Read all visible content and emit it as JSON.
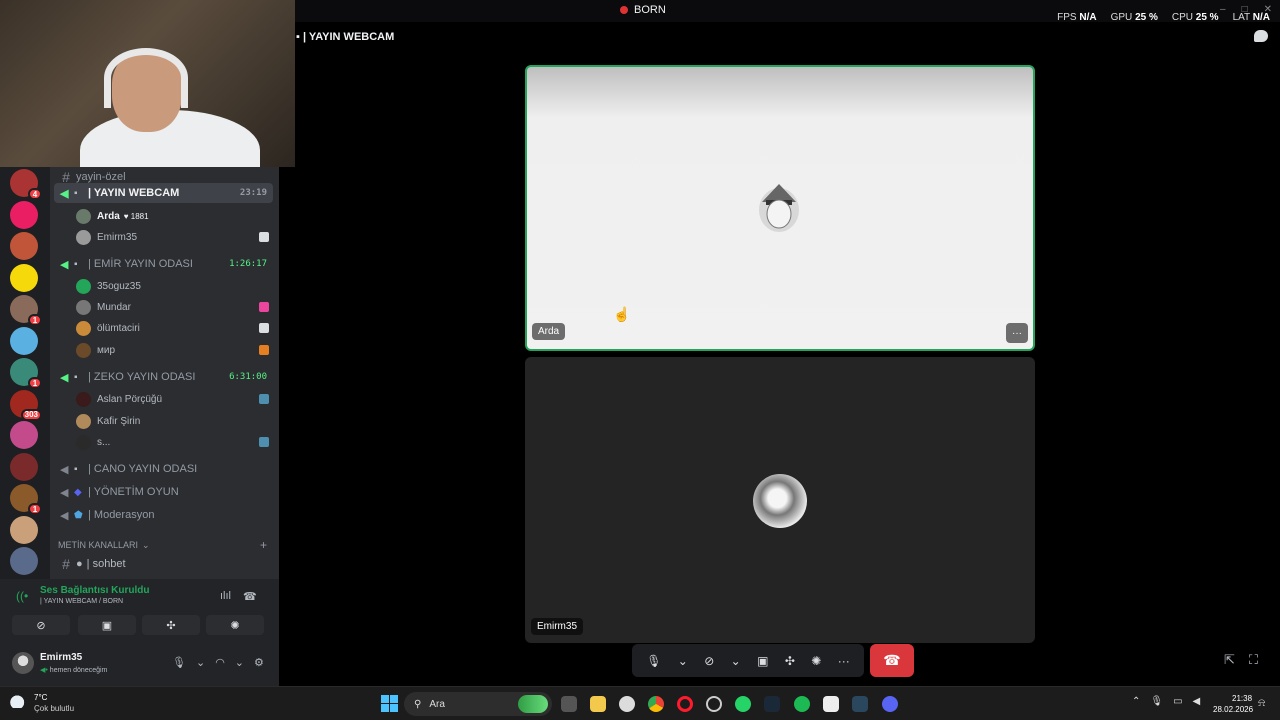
{
  "window": {
    "title": "BORN",
    "stats": [
      {
        "label": "FPS",
        "value": "N/A"
      },
      {
        "label": "GPU",
        "value": "25 %"
      },
      {
        "label": "CPU",
        "value": "25 %"
      },
      {
        "label": "LAT",
        "value": "N/A"
      }
    ]
  },
  "stage": {
    "channel_title": "| YAYIN WEBCAM",
    "tiles": [
      {
        "name": "Arda",
        "speaking": true
      },
      {
        "name": "Emirm35",
        "speaking": false
      }
    ]
  },
  "sidebar": {
    "top_channel": "yayin-özel",
    "voice_channels": [
      {
        "name": "| YAYIN WEBCAM",
        "timer": "23:19",
        "active": true,
        "users": [
          {
            "name": "Arda",
            "extra": "1881"
          },
          {
            "name": "Emirm35"
          }
        ]
      },
      {
        "name": "| EMİR YAYIN ODASI",
        "timer": "1:26:17",
        "users": [
          {
            "name": "35oguz35"
          },
          {
            "name": "Mundar"
          },
          {
            "name": "ölümtaciri"
          },
          {
            "name": "мир"
          }
        ]
      },
      {
        "name": "| ZEKO YAYIN ODASI",
        "timer": "6:31:00",
        "users": [
          {
            "name": "Aslan Pörçüğü"
          },
          {
            "name": "Kafir Şirin"
          },
          {
            "name": "s..."
          }
        ]
      },
      {
        "name": "| CANO YAYIN ODASI"
      },
      {
        "name": "| YÖNETİM OYUN"
      },
      {
        "name": "| Moderasyon"
      }
    ],
    "text_category": "METİN KANALLARI",
    "text_channels": [
      "| sohbet"
    ]
  },
  "servers": [
    {
      "badge": "4"
    },
    {
      "badge": ""
    },
    {
      "badge": ""
    },
    {
      "badge": ""
    },
    {
      "badge": "1"
    },
    {
      "badge": ""
    },
    {
      "badge": "1"
    },
    {
      "badge": "303"
    },
    {
      "badge": ""
    },
    {
      "badge": ""
    },
    {
      "badge": "1"
    },
    {
      "badge": ""
    },
    {
      "badge": ""
    }
  ],
  "voice_panel": {
    "status": "Ses Bağlantısı Kuruldu",
    "location": "| YAYIN WEBCAM / BORN"
  },
  "user_panel": {
    "name": "Emirm35",
    "status": "hemen döneceğim"
  },
  "taskbar": {
    "weather_temp": "7°C",
    "weather_desc": "Çok bulutlu",
    "search_placeholder": "Ara",
    "time": "21:38",
    "date": "28.02.2026"
  },
  "colors": {
    "accent_green": "#23a55a",
    "hangup_red": "#da373c",
    "sidebar_bg": "#2b2d31",
    "rail_bg": "#1e1f22"
  },
  "icons": [
    "microphone-icon",
    "camera-off-icon",
    "screen-share-icon",
    "activities-icon",
    "soundboard-icon",
    "more-icon",
    "hangup-icon",
    "popout-icon",
    "fullscreen-icon",
    "headphones-icon",
    "settings-icon",
    "chat-icon"
  ]
}
